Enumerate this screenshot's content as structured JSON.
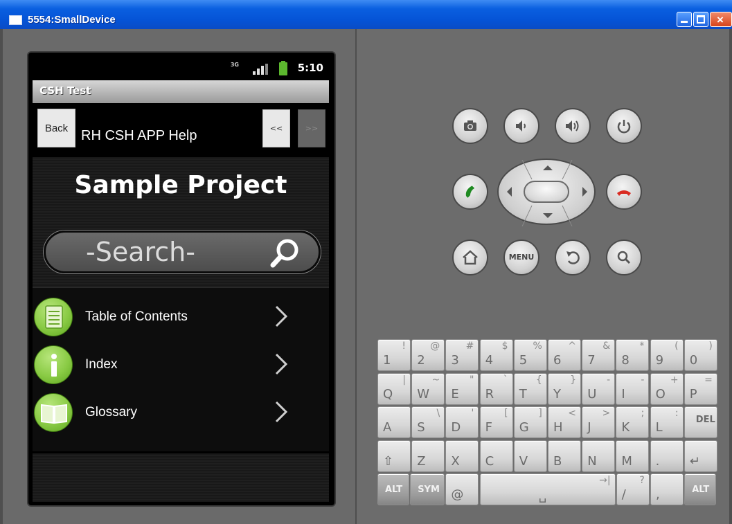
{
  "window": {
    "title": "5554:SmallDevice"
  },
  "status_bar": {
    "network": "3G",
    "time": "5:10"
  },
  "app": {
    "title": "CSH Test"
  },
  "toolbar": {
    "back_label": "Back",
    "help_title": "RH CSH APP Help",
    "prev_label": "<<",
    "next_label": ">>"
  },
  "content": {
    "project_title": "Sample Project",
    "search_placeholder": "-Search-"
  },
  "menu": {
    "items": [
      {
        "label": "Table of Contents",
        "icon": "toc-icon"
      },
      {
        "label": "Index",
        "icon": "info-icon"
      },
      {
        "label": "Glossary",
        "icon": "book-icon"
      }
    ]
  },
  "controls": {
    "menu_label": "MENU"
  },
  "keyboard": {
    "rows": [
      [
        {
          "k": "1",
          "a": "!"
        },
        {
          "k": "2",
          "a": "@"
        },
        {
          "k": "3",
          "a": "#"
        },
        {
          "k": "4",
          "a": "$"
        },
        {
          "k": "5",
          "a": "%"
        },
        {
          "k": "6",
          "a": "^"
        },
        {
          "k": "7",
          "a": "&"
        },
        {
          "k": "8",
          "a": "*"
        },
        {
          "k": "9",
          "a": "("
        },
        {
          "k": "0",
          "a": ")"
        }
      ],
      [
        {
          "k": "Q",
          "a": "|"
        },
        {
          "k": "W",
          "a": "~"
        },
        {
          "k": "E",
          "a": "\""
        },
        {
          "k": "R",
          "a": "`"
        },
        {
          "k": "T",
          "a": "{"
        },
        {
          "k": "Y",
          "a": "}"
        },
        {
          "k": "U",
          "a": "-"
        },
        {
          "k": "I",
          "a": "-"
        },
        {
          "k": "O",
          "a": "+"
        },
        {
          "k": "P",
          "a": "="
        }
      ],
      [
        {
          "k": "A",
          "a": ""
        },
        {
          "k": "S",
          "a": "\\"
        },
        {
          "k": "D",
          "a": "'"
        },
        {
          "k": "F",
          "a": "["
        },
        {
          "k": "G",
          "a": "]"
        },
        {
          "k": "H",
          "a": "<"
        },
        {
          "k": "J",
          "a": ">"
        },
        {
          "k": "K",
          "a": ";"
        },
        {
          "k": "L",
          "a": ":"
        },
        {
          "k": "DEL",
          "a": ""
        }
      ],
      [
        {
          "k": "⇧",
          "a": ""
        },
        {
          "k": "Z",
          "a": ""
        },
        {
          "k": "X",
          "a": ""
        },
        {
          "k": "C",
          "a": ""
        },
        {
          "k": "V",
          "a": ""
        },
        {
          "k": "B",
          "a": ""
        },
        {
          "k": "N",
          "a": ""
        },
        {
          "k": "M",
          "a": ""
        },
        {
          "k": ".",
          "a": ""
        },
        {
          "k": "↵",
          "a": ""
        }
      ],
      [
        {
          "k": "ALT",
          "a": ""
        },
        {
          "k": "SYM",
          "a": ""
        },
        {
          "k": "@",
          "a": ""
        },
        {
          "k": "␣",
          "a": "→|"
        },
        {
          "k": "/",
          "a": "?"
        },
        {
          "k": ",",
          "a": ""
        },
        {
          "k": "ALT",
          "a": ""
        }
      ]
    ]
  }
}
